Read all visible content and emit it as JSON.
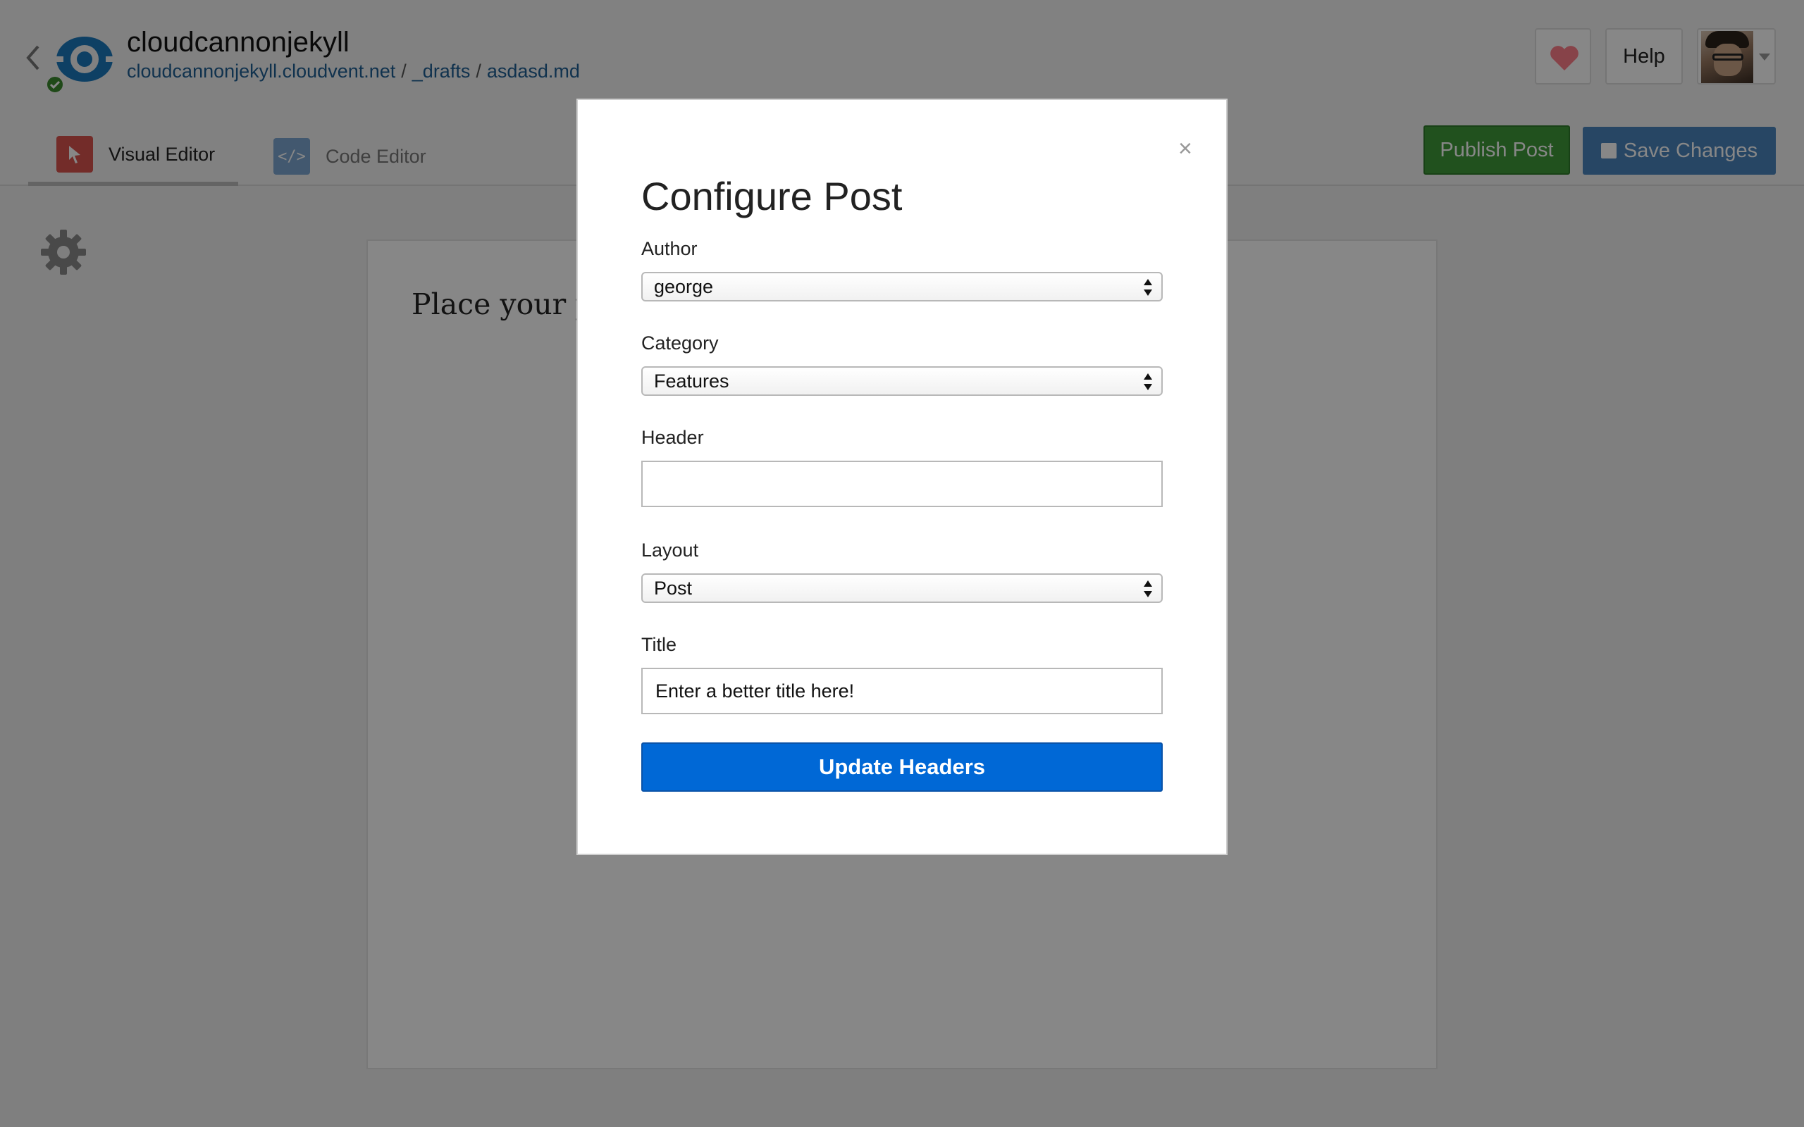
{
  "site": {
    "name": "cloudcannonjekyll",
    "breadcrumb": [
      "cloudcannonjekyll.cloudvent.net",
      "_drafts",
      "asdasd.md"
    ],
    "breadcrumb_sep": "/"
  },
  "header": {
    "help_label": "Help",
    "publish_label": "Publish Post",
    "save_label": "Save Changes"
  },
  "tabs": {
    "visual": "Visual Editor",
    "code": "Code Editor",
    "code_icon_text": "</>"
  },
  "editor": {
    "placeholder": "Place your post content here..."
  },
  "modal": {
    "title": "Configure Post",
    "close": "×",
    "fields": {
      "author": {
        "label": "Author",
        "value": "george"
      },
      "category": {
        "label": "Category",
        "value": "Features"
      },
      "header": {
        "label": "Header",
        "value": ""
      },
      "layout": {
        "label": "Layout",
        "value": "Post"
      },
      "title": {
        "label": "Title",
        "value": "Enter a better title here!"
      }
    },
    "submit_label": "Update Headers"
  },
  "colors": {
    "publish": "#3f9a3a",
    "save": "#4a84bd",
    "primary": "#0068d6",
    "breadcrumb": "#1f5f94",
    "heart": "#ff7f8a"
  },
  "icons": [
    "back-chevron-icon",
    "site-logo-icon",
    "status-check-icon",
    "heart-icon",
    "avatar",
    "cursor-icon",
    "code-icon",
    "disk-icon",
    "gear-icon",
    "close-icon",
    "select-arrows-icon"
  ]
}
